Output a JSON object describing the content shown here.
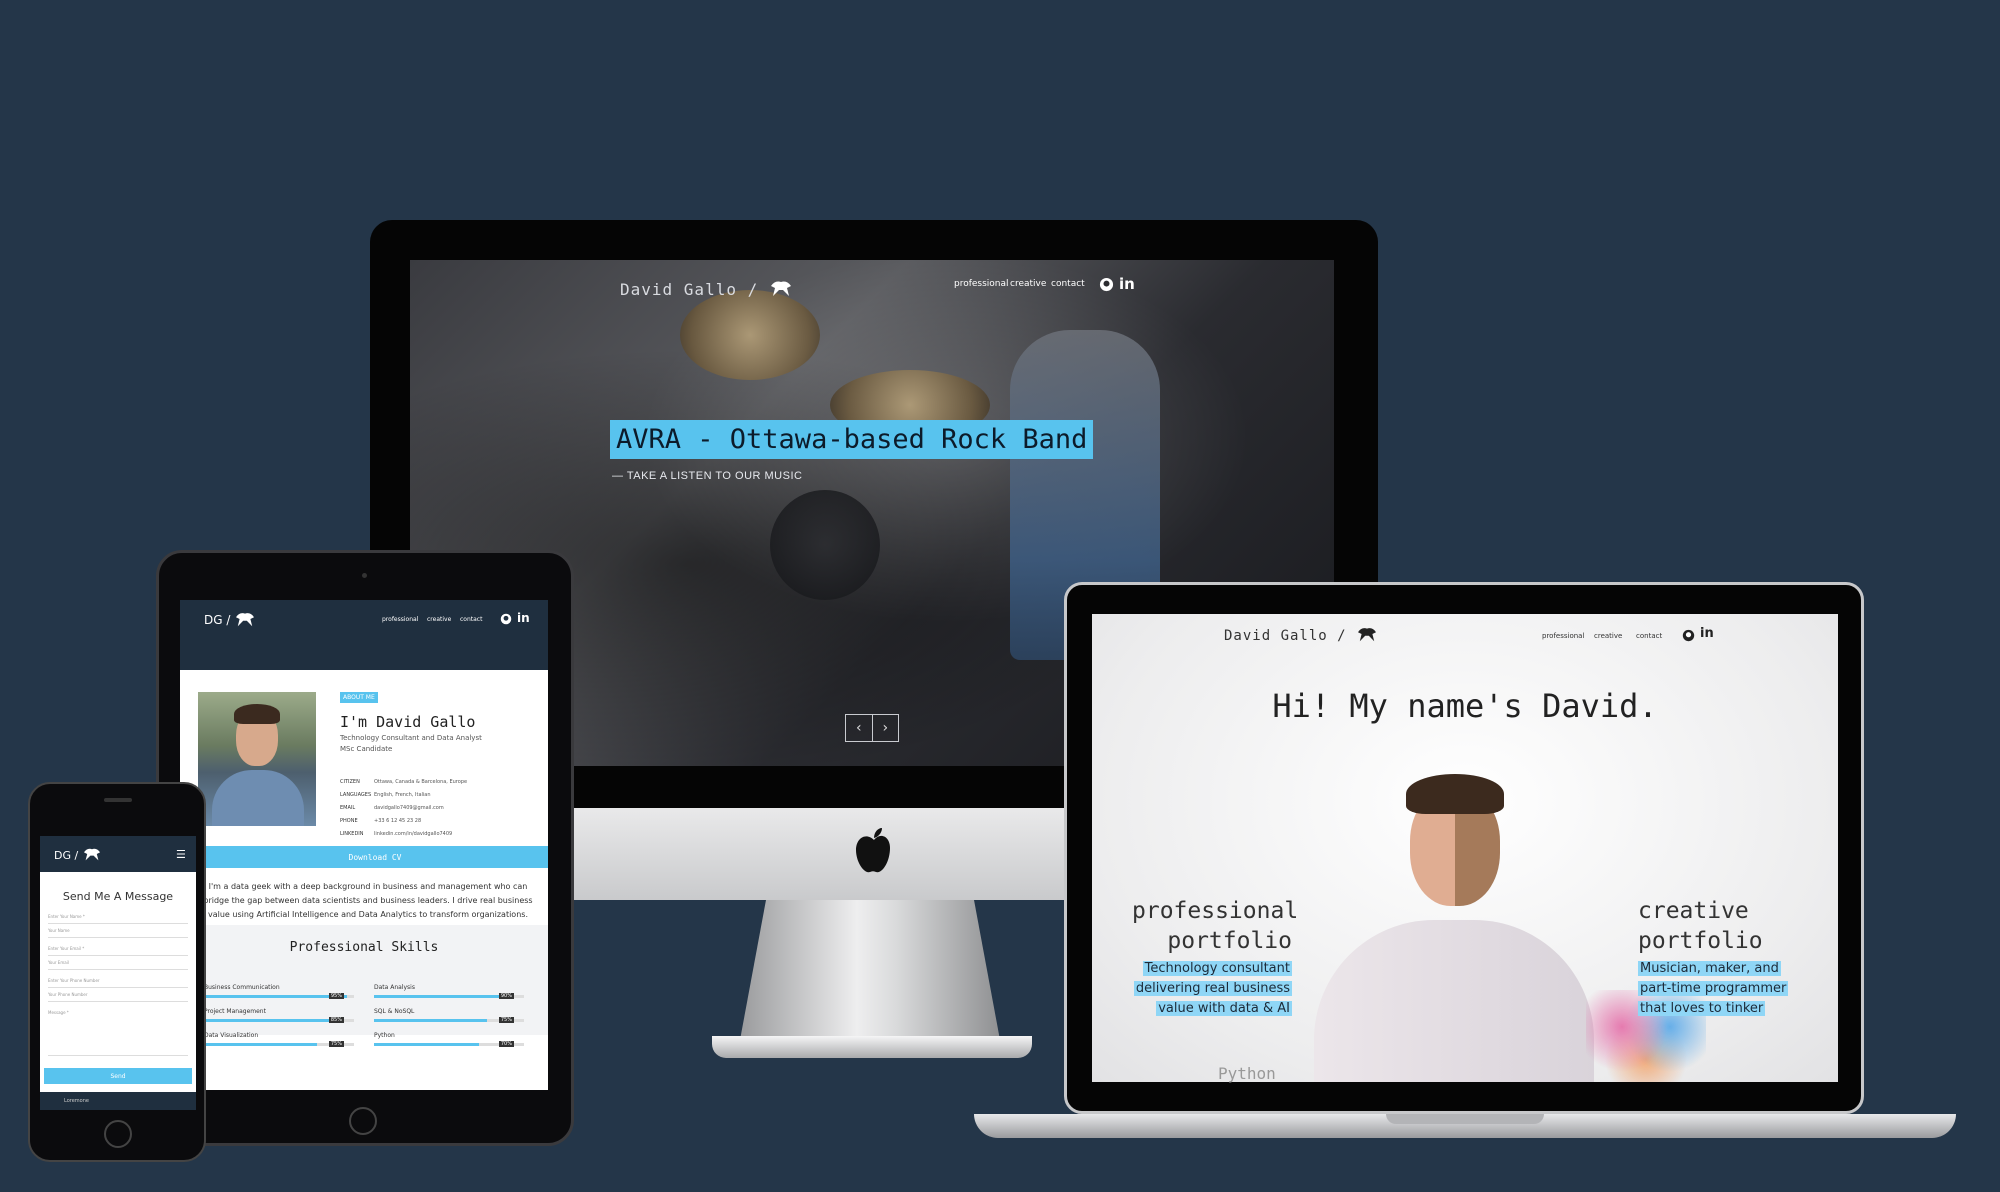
{
  "imac": {
    "logo": "David Gallo /",
    "nav": [
      "professional",
      "creative",
      "contact"
    ],
    "hero_title": "AVRA - Ottawa-based Rock Band",
    "hero_subtitle": "— TAKE A LISTEN TO OUR MUSIC",
    "slider_prev": "‹",
    "slider_next": "›"
  },
  "tablet": {
    "logo": "DG /",
    "nav": [
      "professional",
      "creative",
      "contact"
    ],
    "badge": "ABOUT ME",
    "name": "I'm David Gallo",
    "role_line1": "Technology Consultant and Data Analyst",
    "role_line2": "MSc Candidate",
    "info": [
      {
        "k": "CITIZEN",
        "v": "Ottawa, Canada & Barcelona, Europe"
      },
      {
        "k": "LANGUAGES",
        "v": "English, French, Italian"
      },
      {
        "k": "EMAIL",
        "v": "davidgallo7409@gmail.com"
      },
      {
        "k": "PHONE",
        "v": "+33 6 12 45 23 28"
      },
      {
        "k": "LINKEDIN",
        "v": "linkedin.com/in/davidgallo7409"
      }
    ],
    "download": "Download CV",
    "bio": "I'm a data geek with a deep background in business and management who can bridge the gap between data scientists and business leaders. I drive real business value using Artificial Intelligence and Data Analytics to transform organizations.",
    "skills_title": "Professional Skills",
    "skills": [
      {
        "name": "Business Communication",
        "pct": "95%",
        "level": 0.95
      },
      {
        "name": "Data Analysis",
        "pct": "90%",
        "level": 0.9
      },
      {
        "name": "Project Management",
        "pct": "85%",
        "level": 0.85
      },
      {
        "name": "SQL & NoSQL",
        "pct": "75%",
        "level": 0.75
      },
      {
        "name": "Data Visualization",
        "pct": "75%",
        "level": 0.75
      },
      {
        "name": "Python",
        "pct": "70%",
        "level": 0.7
      }
    ]
  },
  "phone": {
    "logo": "DG /",
    "title": "Send Me A Message",
    "fields": [
      "Enter Your Name *",
      "Your Name",
      "Enter Your Email *",
      "Your Email",
      "Enter Your Phone Number",
      "Your Phone Number",
      "Message *"
    ],
    "send": "Send",
    "footer": "Loremone"
  },
  "laptop": {
    "logo": "David Gallo /",
    "nav": [
      "professional",
      "creative",
      "contact"
    ],
    "greeting": "Hi! My name's David.",
    "professional_title_1": "professional",
    "professional_title_2": "portfolio",
    "professional_desc": [
      "Technology consultant",
      "delivering real business",
      "value with data & AI"
    ],
    "creative_title_1": "creative",
    "creative_title_2": "portfolio",
    "creative_desc": [
      "Musician, maker, and",
      "part-time programmer",
      "that loves to tinker"
    ],
    "python": "Python"
  },
  "colors": {
    "accent": "#58c3ee",
    "background": "#243649"
  },
  "icons": [
    "github-icon",
    "linkedin-icon",
    "monkey-logo-icon",
    "apple-logo-icon",
    "menu-icon"
  ]
}
